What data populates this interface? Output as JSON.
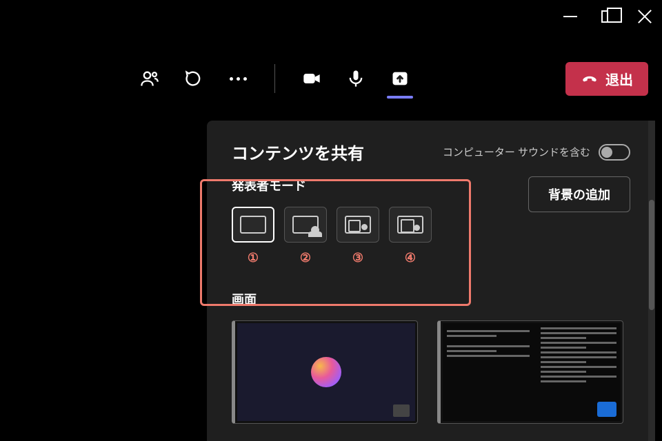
{
  "titlebar": {
    "minimize": "minimize",
    "restore": "restore",
    "close": "close"
  },
  "toolbar": {
    "people": "participants",
    "chat": "chat",
    "more": "more-actions",
    "camera": "camera",
    "mic": "microphone",
    "share": "share",
    "leave_label": "退出"
  },
  "panel": {
    "title": "コンテンツを共有",
    "sound_label": "コンピューター サウンドを含む",
    "presenter_label": "発表者モード",
    "add_background_label": "背景の追加",
    "screen_label": "画面"
  },
  "annotations": {
    "n1": "①",
    "n2": "②",
    "n3": "③",
    "n4": "④"
  }
}
